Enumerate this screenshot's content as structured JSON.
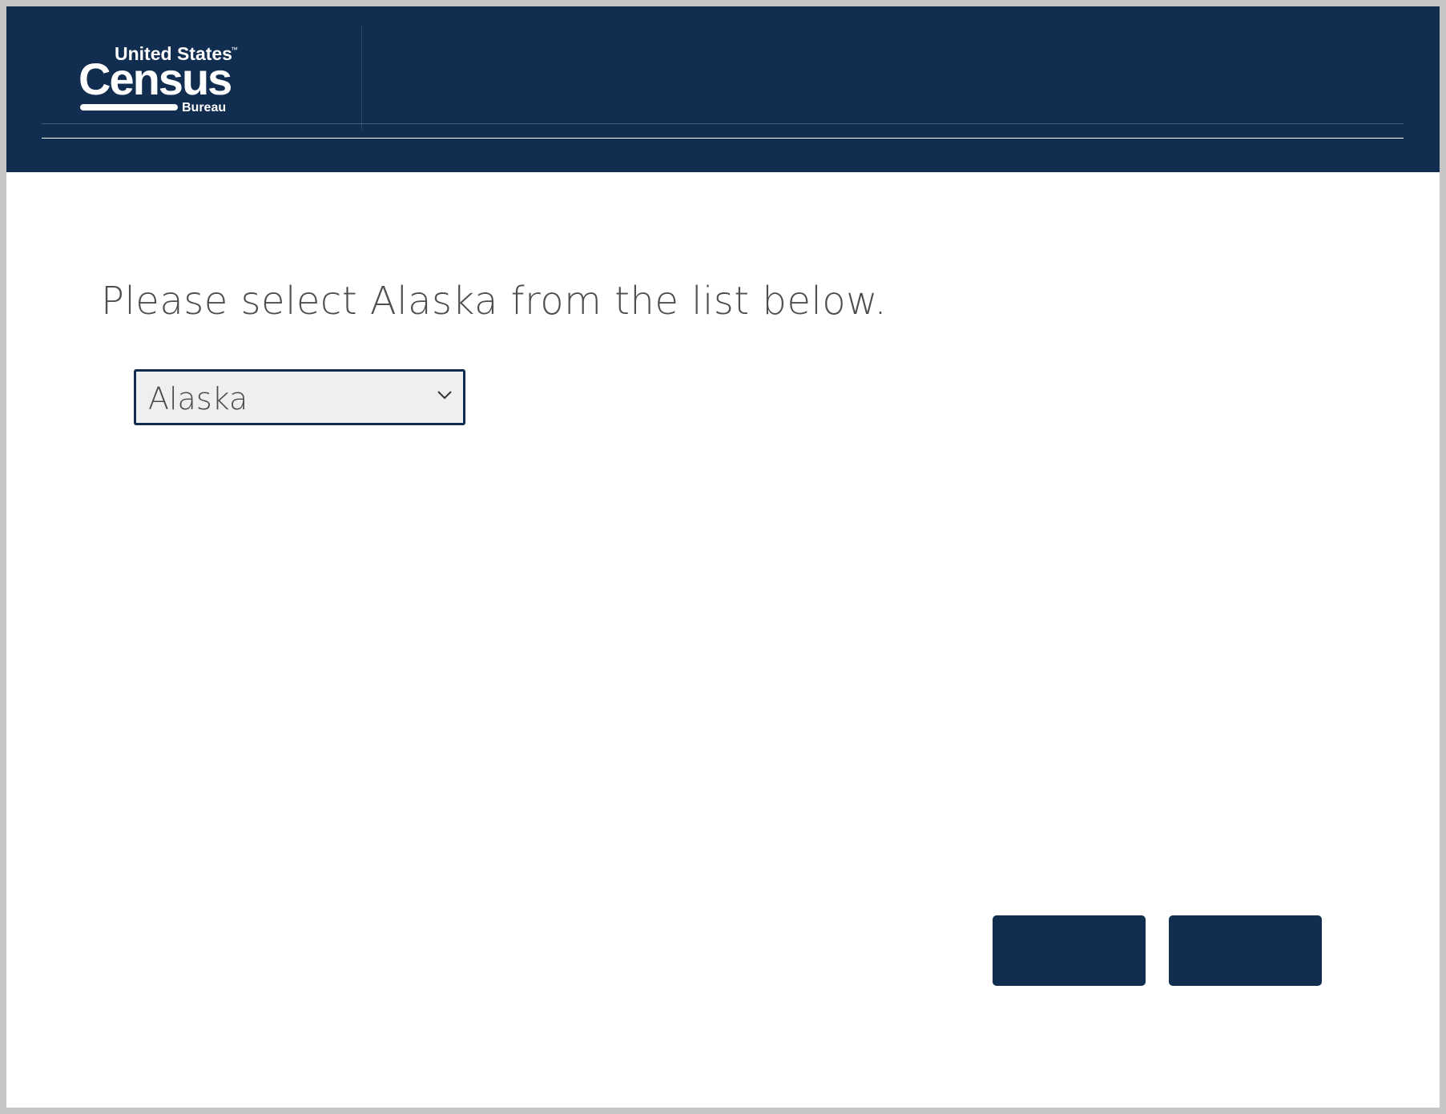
{
  "header": {
    "logo": {
      "line1": "United States",
      "trademark": "™",
      "line2": "Census",
      "line3": "Bureau"
    }
  },
  "main": {
    "prompt": "Please select Alaska from the list below.",
    "state_select": {
      "selected_value": "Alaska"
    }
  },
  "footer": {
    "left_button_label": "",
    "right_button_label": ""
  },
  "colors": {
    "header_bg": "#112d50",
    "button_bg": "#112d50",
    "select_bg": "#efefef",
    "text": "#4e4e4e"
  },
  "icons": {
    "select_chevron": "chevron-down-icon"
  }
}
